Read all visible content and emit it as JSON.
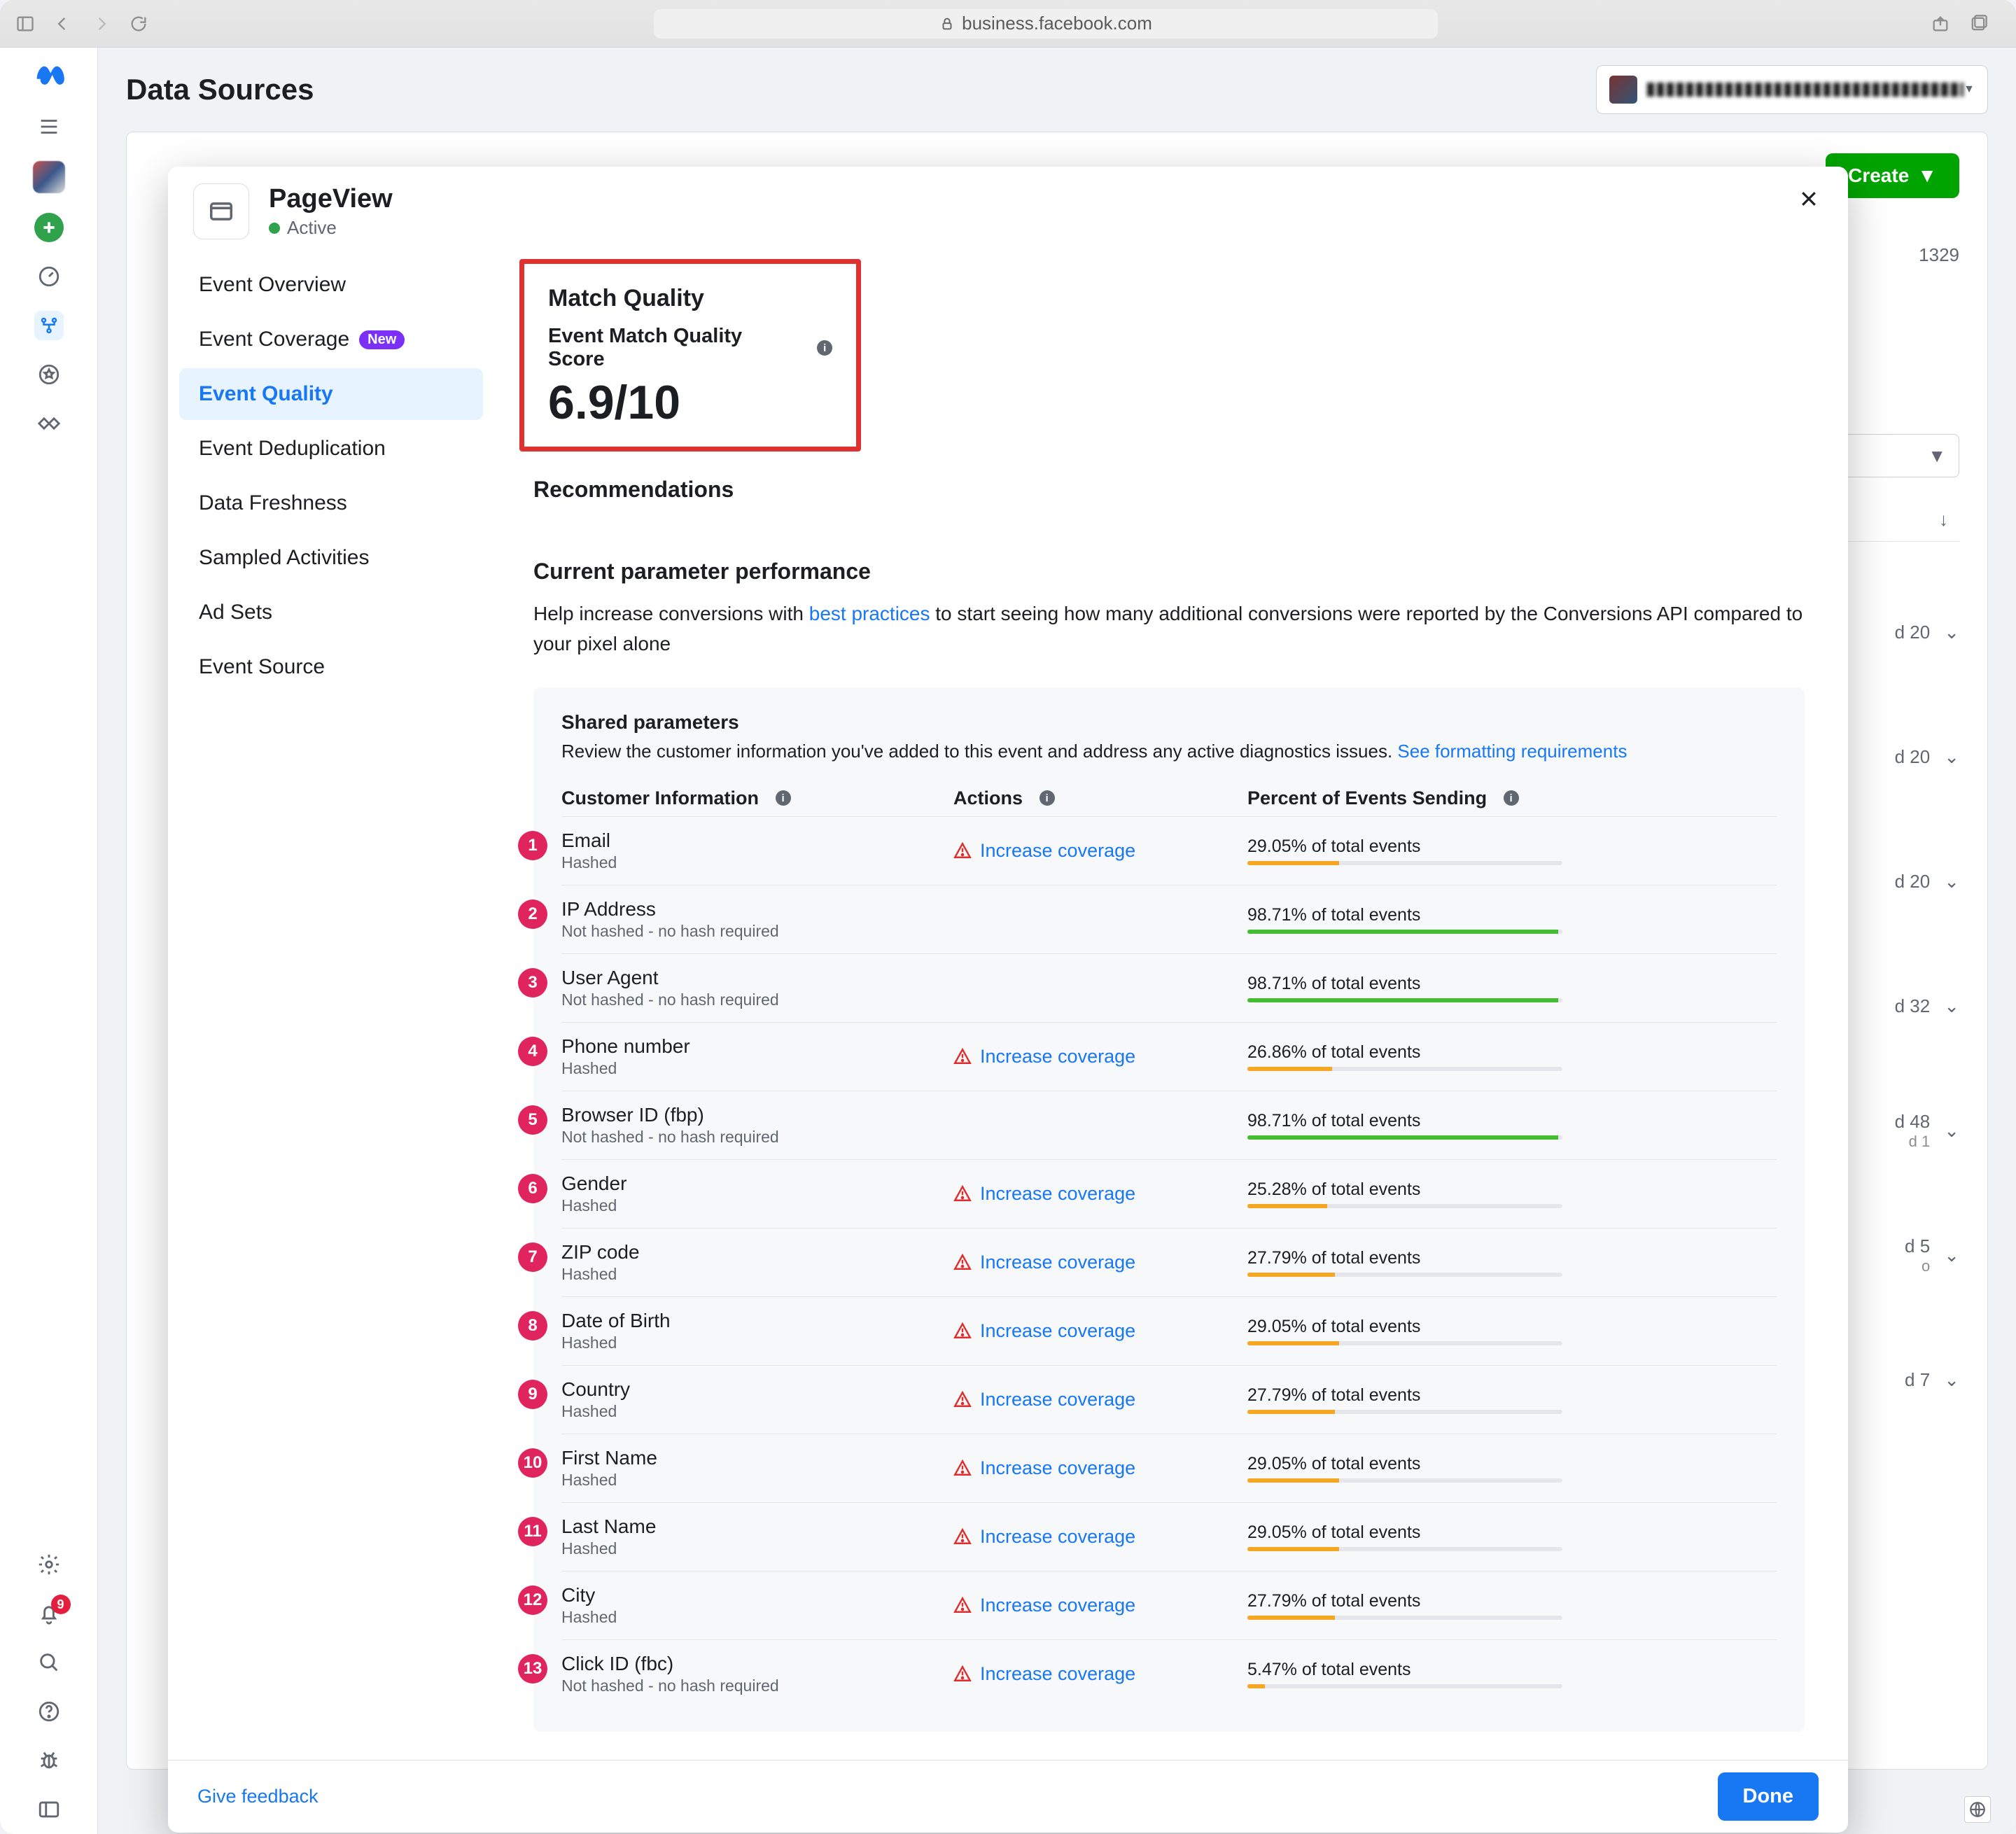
{
  "browser": {
    "url": "business.facebook.com"
  },
  "bg": {
    "title": "Data Sources",
    "create": "Create",
    "id_line": "1329",
    "rows": [
      {
        "t": "d 20"
      },
      {
        "t": "d 20"
      },
      {
        "t": "d 20"
      },
      {
        "t": "d 32"
      },
      {
        "t": "d 48",
        "s": "d 1"
      },
      {
        "t": "d 5",
        "s": "o"
      },
      {
        "t": "d 7"
      }
    ]
  },
  "rail": {
    "notif_count": "9"
  },
  "modal": {
    "event_name": "PageView",
    "status": "Active",
    "nav": {
      "overview": "Event Overview",
      "coverage": "Event Coverage",
      "coverage_badge": "New",
      "quality": "Event Quality",
      "dedup": "Event Deduplication",
      "freshness": "Data Freshness",
      "sampled": "Sampled Activities",
      "adsets": "Ad Sets",
      "source": "Event Source"
    },
    "mq": {
      "heading": "Match Quality",
      "sub": "Event Match Quality Score",
      "score": "6.9/10"
    },
    "rec_heading": "Recommendations",
    "cpp_heading": "Current parameter performance",
    "cpp_help_pre": "Help increase conversions with ",
    "cpp_help_link": "best practices",
    "cpp_help_post": " to start seeing how many additional conversions were reported by the Conversions API compared to your pixel alone",
    "panel": {
      "title": "Shared parameters",
      "sub": "Review the customer information you've added to this event and address any active diagnostics issues. ",
      "sub_link": "See formatting requirements"
    },
    "th": {
      "ci": "Customer Information",
      "ac": "Actions",
      "pe": "Percent of Events Sending"
    },
    "action_label": "Increase coverage",
    "pct_suffix": "% of total events",
    "rows": [
      {
        "n": "1",
        "name": "Email",
        "sub": "Hashed",
        "action": true,
        "pct": 29.05,
        "color": "#f5a623"
      },
      {
        "n": "2",
        "name": "IP Address",
        "sub": "Not hashed - no hash required",
        "action": false,
        "pct": 98.71,
        "color": "#44bd32"
      },
      {
        "n": "3",
        "name": "User Agent",
        "sub": "Not hashed - no hash required",
        "action": false,
        "pct": 98.71,
        "color": "#44bd32"
      },
      {
        "n": "4",
        "name": "Phone number",
        "sub": "Hashed",
        "action": true,
        "pct": 26.86,
        "color": "#f5a623"
      },
      {
        "n": "5",
        "name": "Browser ID (fbp)",
        "sub": "Not hashed - no hash required",
        "action": false,
        "pct": 98.71,
        "color": "#44bd32"
      },
      {
        "n": "6",
        "name": "Gender",
        "sub": "Hashed",
        "action": true,
        "pct": 25.28,
        "color": "#f5a623"
      },
      {
        "n": "7",
        "name": "ZIP code",
        "sub": "Hashed",
        "action": true,
        "pct": 27.79,
        "color": "#f5a623"
      },
      {
        "n": "8",
        "name": "Date of Birth",
        "sub": "Hashed",
        "action": true,
        "pct": 29.05,
        "color": "#f5a623"
      },
      {
        "n": "9",
        "name": "Country",
        "sub": "Hashed",
        "action": true,
        "pct": 27.79,
        "color": "#f5a623"
      },
      {
        "n": "10",
        "name": "First Name",
        "sub": "Hashed",
        "action": true,
        "pct": 29.05,
        "color": "#f5a623"
      },
      {
        "n": "11",
        "name": "Last Name",
        "sub": "Hashed",
        "action": true,
        "pct": 29.05,
        "color": "#f5a623"
      },
      {
        "n": "12",
        "name": "City",
        "sub": "Hashed",
        "action": true,
        "pct": 27.79,
        "color": "#f5a623"
      },
      {
        "n": "13",
        "name": "Click ID (fbc)",
        "sub": "Not hashed - no hash required",
        "action": true,
        "pct": 5.47,
        "color": "#f5a623"
      }
    ],
    "footer": {
      "feedback": "Give feedback",
      "done": "Done"
    }
  }
}
